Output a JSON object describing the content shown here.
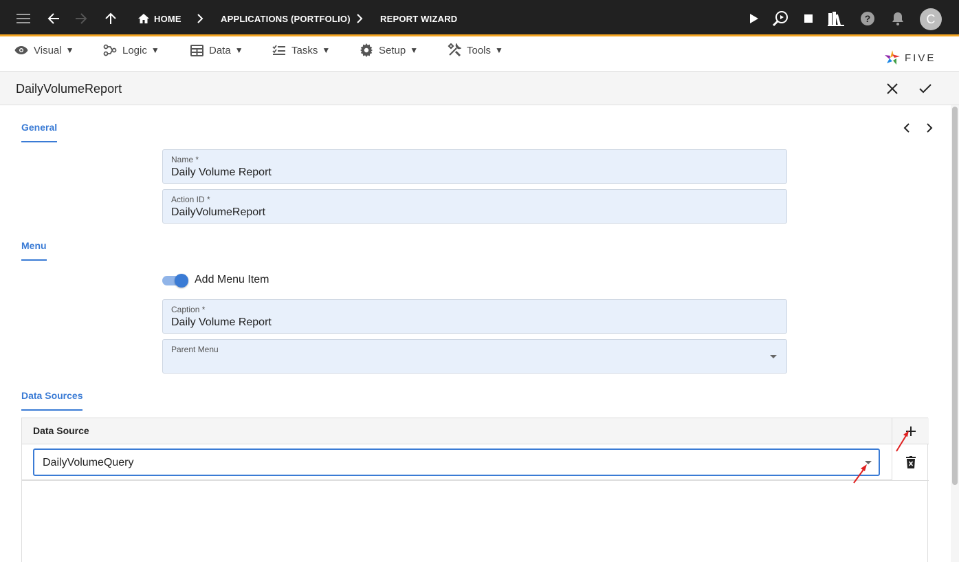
{
  "topbar": {
    "breadcrumbs": [
      "HOME",
      "APPLICATIONS (PORTFOLIO)",
      "REPORT WIZARD"
    ],
    "avatar_initial": "C"
  },
  "menubar": {
    "items": [
      {
        "label": "Visual",
        "icon": "eye-icon"
      },
      {
        "label": "Logic",
        "icon": "logic-icon"
      },
      {
        "label": "Data",
        "icon": "table-icon"
      },
      {
        "label": "Tasks",
        "icon": "tasks-icon"
      },
      {
        "label": "Setup",
        "icon": "gear-icon"
      },
      {
        "label": "Tools",
        "icon": "tools-icon"
      }
    ],
    "caret": "▼",
    "logo_text": "FIVE"
  },
  "form": {
    "title": "DailyVolumeReport",
    "sections": {
      "general": "General",
      "menu": "Menu",
      "data_sources": "Data Sources"
    },
    "name": {
      "label": "Name *",
      "value": "Daily Volume Report"
    },
    "action_id": {
      "label": "Action ID *",
      "value": "DailyVolumeReport"
    },
    "add_menu_item": {
      "label": "Add Menu Item",
      "checked": true
    },
    "caption": {
      "label": "Caption *",
      "value": "Daily Volume Report"
    },
    "parent_menu": {
      "label": "Parent Menu",
      "value": ""
    },
    "data_source_grid": {
      "header": "Data Source",
      "rows": [
        {
          "value": "DailyVolumeQuery"
        }
      ]
    }
  },
  "colors": {
    "accent": "#3a7bd5",
    "topbar_bg": "#212121",
    "topbar_border": "#f5a623",
    "field_bg": "#e8f0fb",
    "annotation": "#e02020"
  }
}
